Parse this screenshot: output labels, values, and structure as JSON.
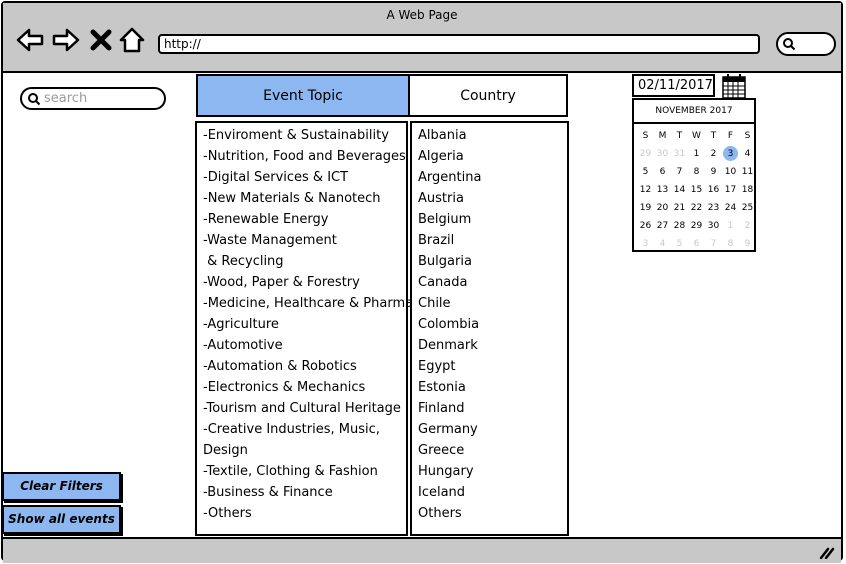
{
  "window": {
    "title": "A Web Page"
  },
  "browser": {
    "url": "http://"
  },
  "search": {
    "placeholder": "search"
  },
  "tabs": {
    "topic": "Event Topic",
    "country": "Country"
  },
  "topics": [
    "-Enviroment & Sustainability",
    "-Nutrition, Food and Beverages",
    "-Digital Services & ICT",
    "-New Materials & Nanotech",
    "-Renewable Energy",
    "-Waste Management",
    " & Recycling",
    "-Wood, Paper & Forestry",
    "-Medicine, Healthcare & Pharma",
    "-Agriculture",
    "-Automotive",
    "-Automation & Robotics",
    "-Electronics & Mechanics",
    "-Tourism and Cultural Heritage",
    "-Creative Industries, Music,",
    "Design",
    "-Textile, Clothing & Fashion",
    "-Business & Finance",
    "-Others"
  ],
  "countries": [
    "Albania",
    "Algeria",
    "Argentina",
    "Austria",
    "Belgium",
    "Brazil",
    "Bulgaria",
    "Canada",
    "Chile",
    "Colombia",
    "Denmark",
    "Egypt",
    "Estonia",
    "Finland",
    "Germany",
    "Greece",
    "Hungary",
    "Iceland",
    "Others"
  ],
  "date": {
    "value": "02/11/2017"
  },
  "calendar": {
    "month": "NOVEMBER 2017",
    "weekdays": [
      "S",
      "M",
      "T",
      "W",
      "T",
      "F",
      "S"
    ],
    "days": [
      [
        "29",
        "30",
        "31",
        "1",
        "2",
        "3",
        "4"
      ],
      [
        "5",
        "6",
        "7",
        "8",
        "9",
        "10",
        "11"
      ],
      [
        "12",
        "13",
        "14",
        "15",
        "16",
        "17",
        "18"
      ],
      [
        "19",
        "20",
        "21",
        "22",
        "23",
        "24",
        "25"
      ],
      [
        "26",
        "27",
        "28",
        "29",
        "30",
        "1",
        "2"
      ],
      [
        "3",
        "4",
        "5",
        "6",
        "7",
        "8",
        "9"
      ]
    ],
    "selected": "3"
  },
  "buttons": {
    "clear": "Clear Filters",
    "show_all": "Show all events"
  },
  "colors": {
    "accent": "#8db7f0",
    "chrome": "#c8c8c8"
  }
}
